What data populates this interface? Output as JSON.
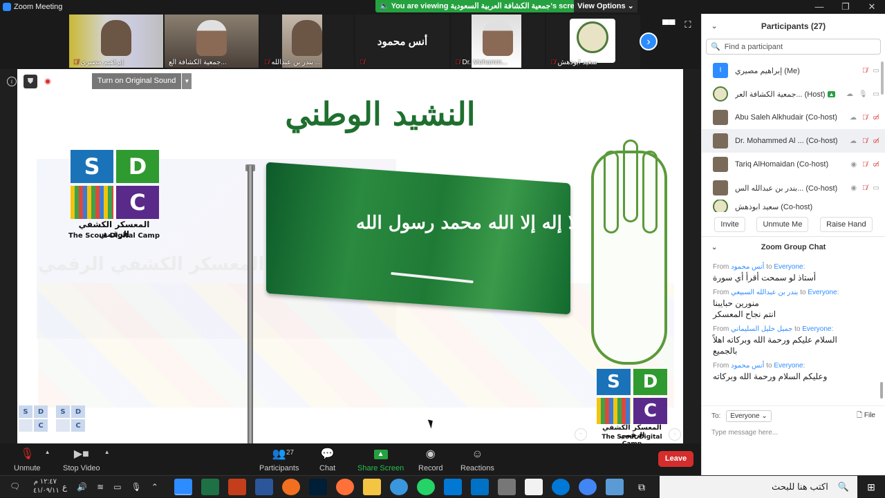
{
  "window": {
    "title": "Zoom Meeting",
    "controls": [
      "—",
      "❐",
      "✕"
    ]
  },
  "share_banner": {
    "text": "You are viewing جمعية الكشافة العربية السعودية's screen",
    "color": "#25a140"
  },
  "view_options": {
    "label": "View Options ⌄"
  },
  "thumbnails": [
    {
      "name": "إبراهيم مصيري",
      "muted": true
    },
    {
      "name": "جمعية الكشافة الع...",
      "muted": false,
      "active": true
    },
    {
      "name": "بندر بن عبدالله ...",
      "muted": true
    },
    {
      "name": "أنس محمود",
      "muted": true,
      "name_only": true
    },
    {
      "name": "Dr. Mohamm...",
      "muted": true
    },
    {
      "name": "سعيد ابوذهش",
      "muted": true
    }
  ],
  "stage": {
    "original_sound": "Turn on Original Sound",
    "slide_title": "النشيد الوطني",
    "flag_text": "لا إله إلا الله محمد رسول الله",
    "sdc_caption_ar": "المعسكر الكشفي الرقمي",
    "sdc_caption_en": "The Scout Digital Camp",
    "ghost_text": "المعسكر الكشفي الرقمي",
    "letters": {
      "s": "S",
      "d": "D",
      "c": "C"
    }
  },
  "toolbar": {
    "unmute": "Unmute",
    "stop_video": "Stop Video",
    "participants": "Participants",
    "participants_count": "27",
    "chat": "Chat",
    "share_screen": "Share Screen",
    "record": "Record",
    "reactions": "Reactions",
    "leave": "Leave"
  },
  "participants_panel": {
    "title": "Participants (27)",
    "search_placeholder": "Find a participant",
    "list": [
      {
        "name": "إبراهيم مصيري (Me)"
      },
      {
        "name": "جمعية الكشافة العر... (Host)"
      },
      {
        "name": "Abu Saleh Alkhudair (Co-host)"
      },
      {
        "name": "Dr. Mohammed Al ... (Co-host)"
      },
      {
        "name": "Tariq AlHomaidan (Co-host)"
      },
      {
        "name": "بندر بن عبدالله الس... (Co-host)"
      },
      {
        "name": "سعيد ابوذهش (Co-host)"
      }
    ],
    "actions": {
      "invite": "Invite",
      "unmute_me": "Unmute Me",
      "raise_hand": "Raise Hand"
    }
  },
  "chat_panel": {
    "title": "Zoom Group Chat",
    "messages": [
      {
        "from": "أنس محمود",
        "to": "Everyone",
        "text": "أستاذ لو سمحت أقرأ أي سورة"
      },
      {
        "from": "بندر بن عبدالله السبيعي",
        "to": "Everyone",
        "text": "منورين حبايبنا\nانتم نجاح المعسكر"
      },
      {
        "from": "جميل خليل السليماني",
        "to": "Everyone",
        "text": "السلام عليكم ورحمة الله وبركاته اهلاً\nبالجميع"
      },
      {
        "from": "أنس محمود",
        "to": "Everyone",
        "text": "وعليكم السلام ورحمة الله وبركاته"
      }
    ],
    "from_word": "From",
    "to_word": "to",
    "to_label": "To:",
    "recipient": "Everyone",
    "file_label": "File",
    "input_placeholder": "Type message here..."
  },
  "taskbar": {
    "search_text": "اكتب هنا للبحث",
    "time": "١٢:٤٧ م",
    "date": "٤١/٠٩/١١",
    "lang": "ع"
  }
}
